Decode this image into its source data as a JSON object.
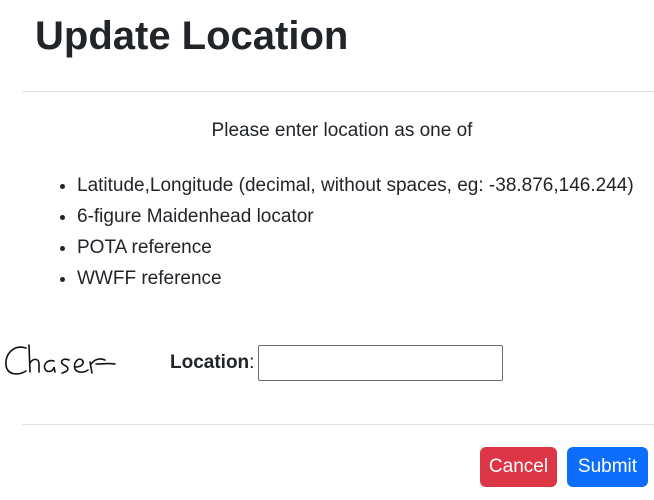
{
  "modal": {
    "title": "Update Location",
    "intro": "Please enter location as one of",
    "options": [
      "Latitude,Longitude (decimal, without spaces, eg: -38.876,146.244)",
      "6-figure Maidenhead locator",
      "POTA reference",
      "WWFF reference"
    ],
    "signature": "Chaser",
    "location_field": {
      "label": "Location",
      "colon": ":",
      "value": "",
      "placeholder": ""
    },
    "buttons": {
      "cancel_label": "Cancel",
      "submit_label": "Submit"
    }
  },
  "colors": {
    "cancel": "#dc3545",
    "submit": "#0d6efd",
    "divider": "#dee2e6",
    "text": "#212529"
  }
}
